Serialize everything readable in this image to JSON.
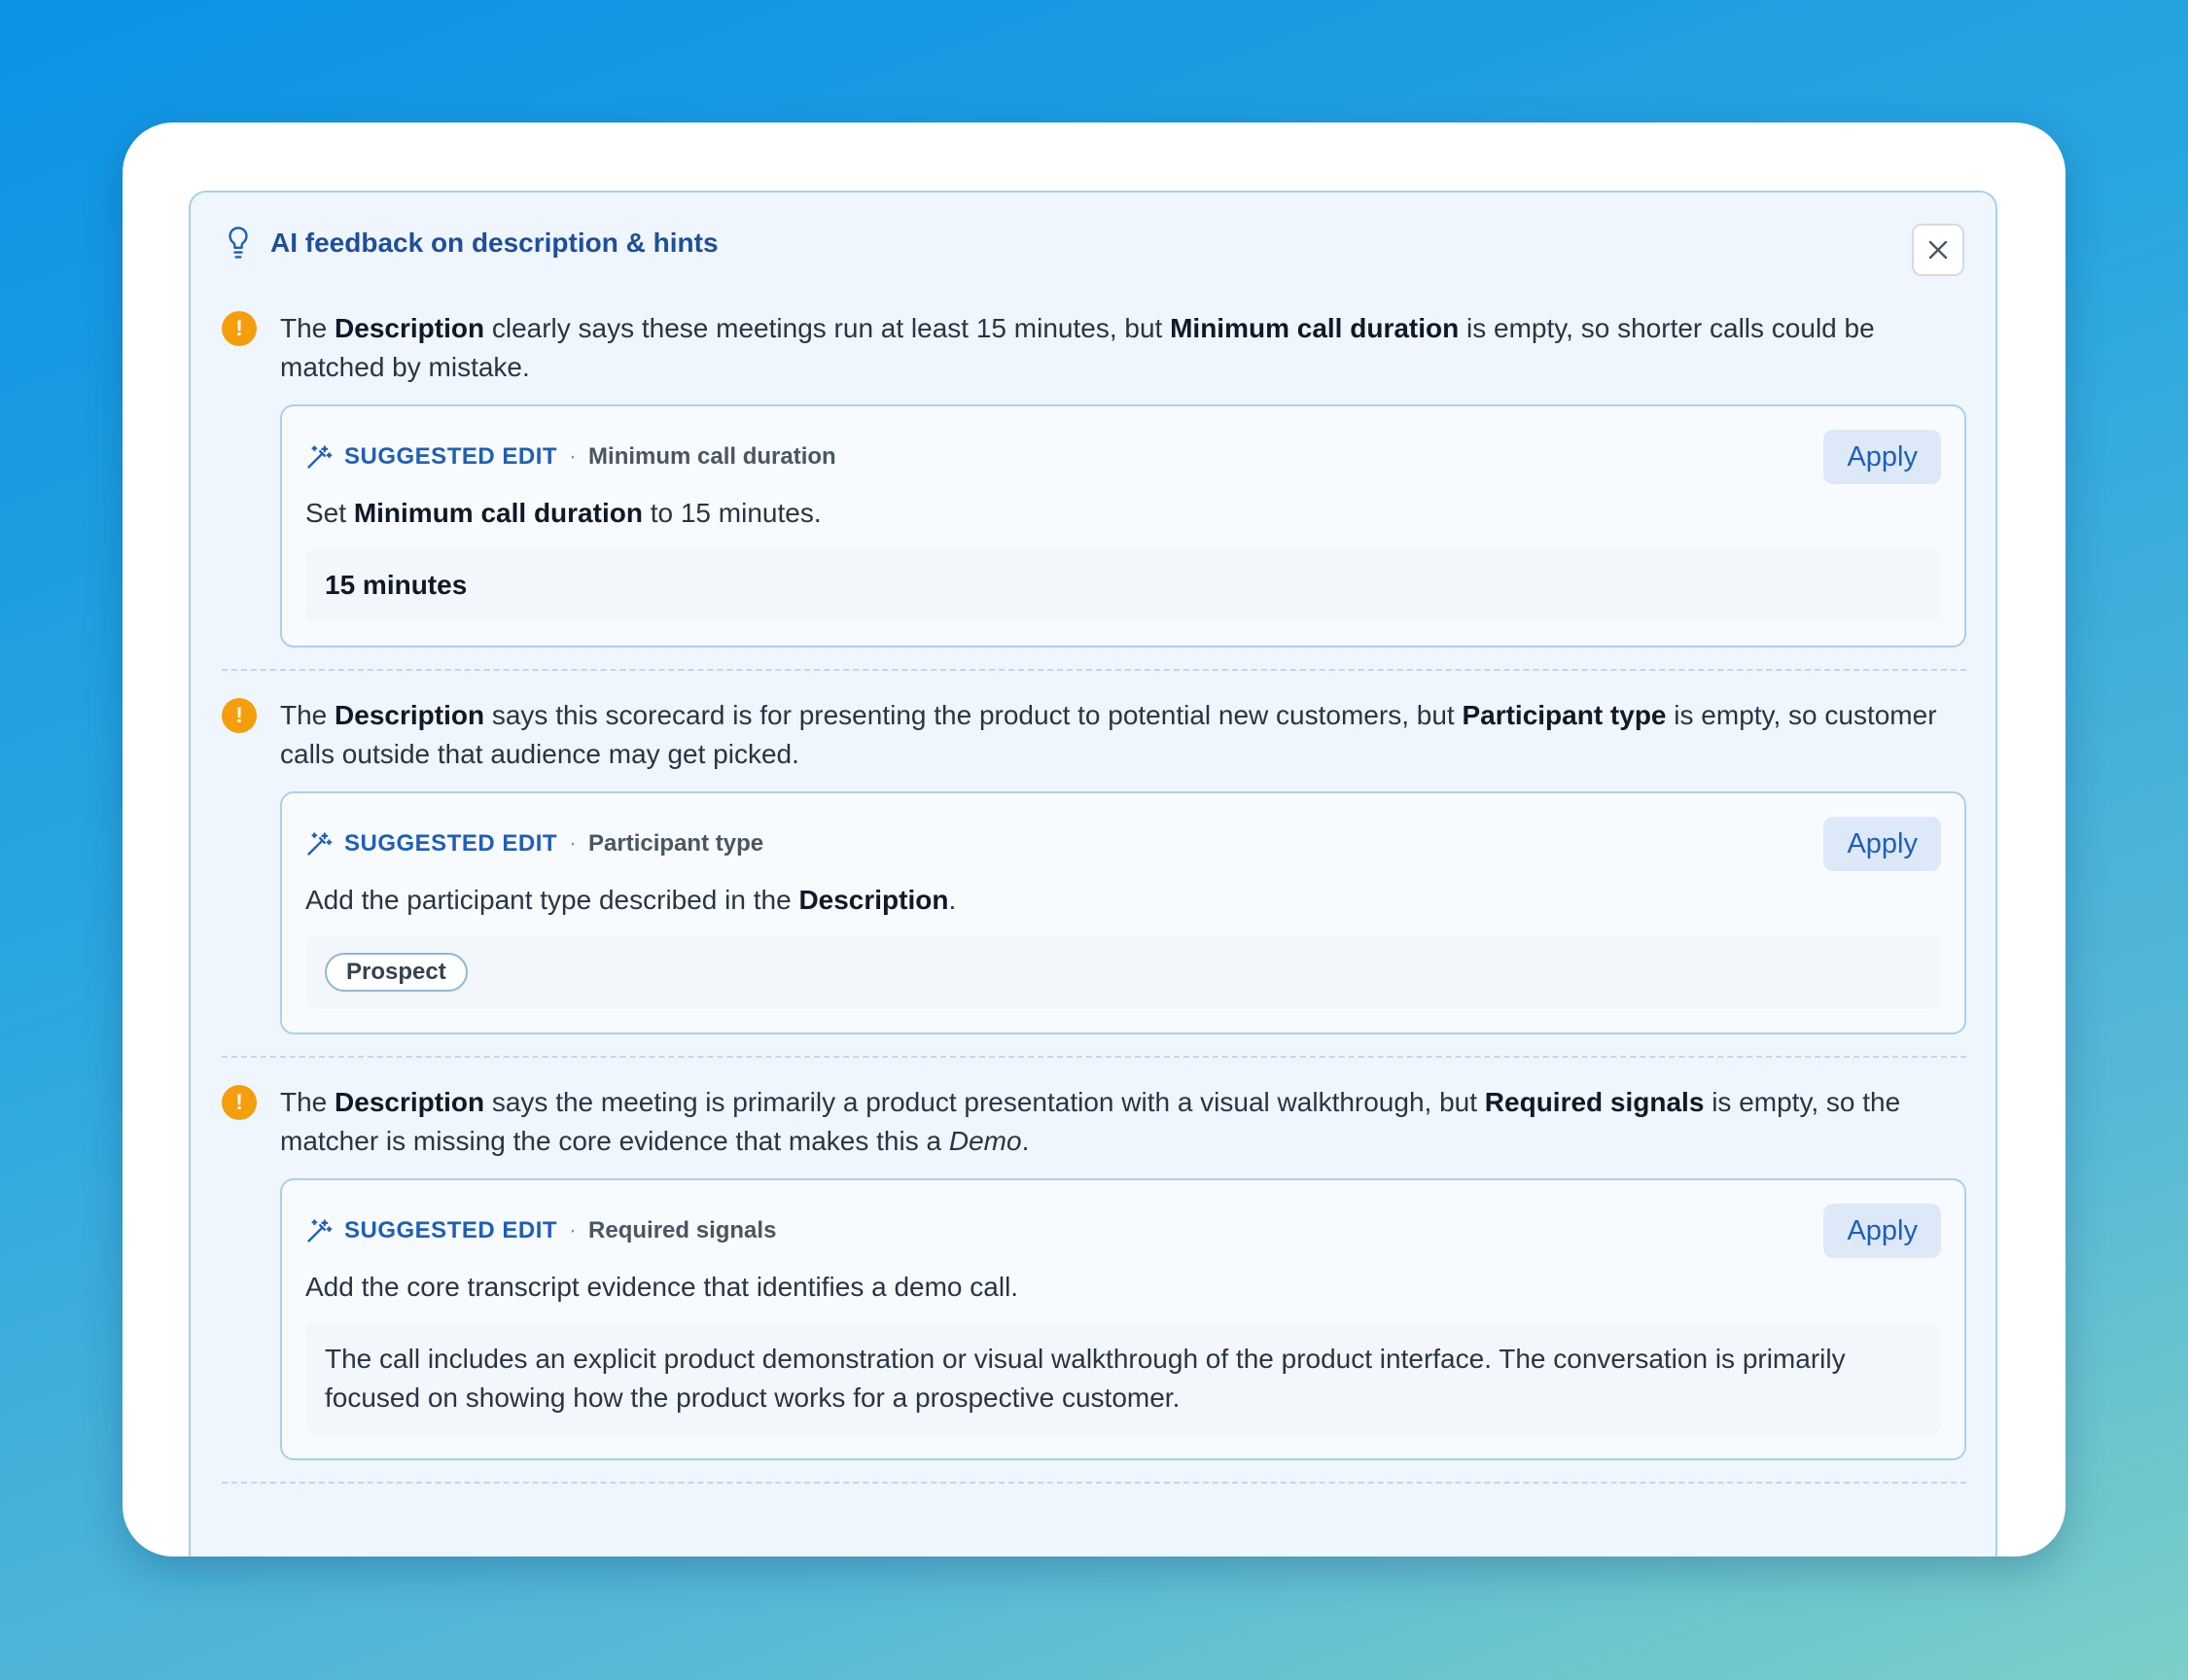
{
  "panel": {
    "title": "AI feedback on description & hints",
    "icon": "lightbulb-icon"
  },
  "items": [
    {
      "msg": [
        "The ",
        "Description",
        " clearly says these meetings run at least 15 minutes, but ",
        "Minimum call duration",
        " is empty, so shorter calls could be matched by mistake."
      ],
      "kicker": "SUGGESTED EDIT",
      "sep": "·",
      "field": "Minimum call duration",
      "apply": "Apply",
      "desc": [
        "Set ",
        "Minimum call duration",
        " to 15 minutes."
      ],
      "value": "15 minutes"
    },
    {
      "msg": [
        "The ",
        "Description",
        " says this scorecard is for presenting the product to potential new customers, but ",
        "Participant type",
        " is empty, so customer calls outside that audience may get picked."
      ],
      "kicker": "SUGGESTED EDIT",
      "sep": "·",
      "field": "Participant type",
      "apply": "Apply",
      "desc": [
        "Add the participant type described in the ",
        "Description",
        "."
      ],
      "chip": "Prospect"
    },
    {
      "msg": [
        "The ",
        "Description",
        " says the meeting is primarily a product presentation with a visual walkthrough, but ",
        "Required signals",
        " is empty, so the matcher is missing the core evidence that makes this a ",
        "Demo",
        "."
      ],
      "kicker": "SUGGESTED EDIT",
      "sep": "·",
      "field": "Required signals",
      "apply": "Apply",
      "desc": "Add the core transcript evidence that identifies a demo call.",
      "value": "The call includes an explicit product demonstration or visual walkthrough of the product interface. The conversation is primarily focused on showing how the product works for a prospective customer."
    }
  ],
  "colors": {
    "accent": "#1f5fb8",
    "warning": "#f59e0b",
    "panel_bg": "#eff6fd",
    "panel_border": "#a9d0ec"
  }
}
